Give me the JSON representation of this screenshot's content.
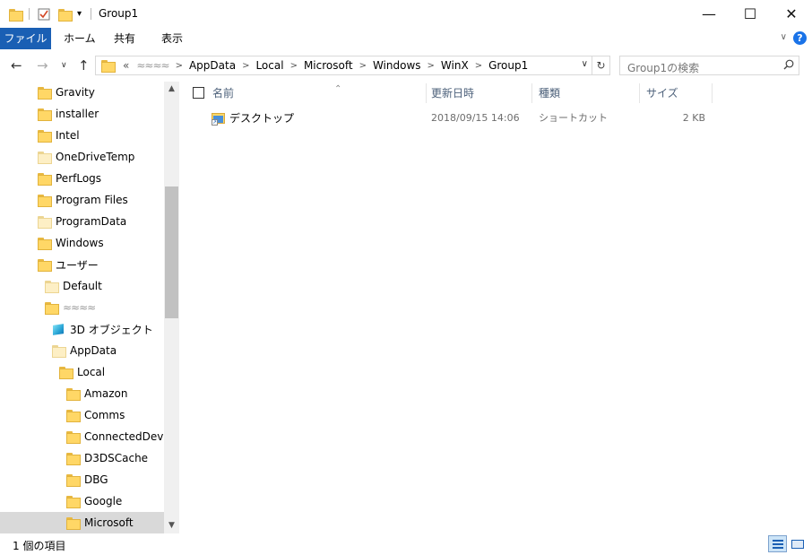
{
  "window": {
    "title": "Group1",
    "controls": {
      "minimize": "—",
      "maximize": "☐",
      "close": "✕"
    }
  },
  "ribbon": {
    "tabs": [
      {
        "label": "ファイル"
      },
      {
        "label": "ホーム"
      },
      {
        "label": "共有"
      },
      {
        "label": "表示"
      }
    ],
    "help": "?"
  },
  "address_bar": {
    "overflow": "«",
    "breadcrumbs": [
      "≈≈≈≈",
      "AppData",
      "Local",
      "Microsoft",
      "Windows",
      "WinX",
      "Group1"
    ]
  },
  "search": {
    "placeholder": "Group1の検索"
  },
  "tree": {
    "items": [
      {
        "label": "Gravity",
        "icon": "folder-icon",
        "indent": 0
      },
      {
        "label": "installer",
        "icon": "folder-icon",
        "indent": 0
      },
      {
        "label": "Intel",
        "icon": "folder-icon",
        "indent": 0
      },
      {
        "label": "OneDriveTemp",
        "icon": "folder-pale-icon",
        "indent": 0
      },
      {
        "label": "PerfLogs",
        "icon": "folder-icon",
        "indent": 0
      },
      {
        "label": "Program Files",
        "icon": "folder-icon",
        "indent": 0
      },
      {
        "label": "ProgramData",
        "icon": "folder-pale-icon",
        "indent": 0
      },
      {
        "label": "Windows",
        "icon": "folder-icon",
        "indent": 0
      },
      {
        "label": "ユーザー",
        "icon": "folder-icon",
        "indent": 0
      },
      {
        "label": "Default",
        "icon": "folder-pale-icon",
        "indent": 1
      },
      {
        "label": "≈≈≈≈",
        "icon": "folder-icon",
        "indent": 1
      },
      {
        "label": "3D オブジェクト",
        "icon": "cube-icon",
        "indent": 2
      },
      {
        "label": "AppData",
        "icon": "folder-pale-icon",
        "indent": 2
      },
      {
        "label": "Local",
        "icon": "folder-icon",
        "indent": 3
      },
      {
        "label": "Amazon",
        "icon": "folder-icon",
        "indent": 4
      },
      {
        "label": "Comms",
        "icon": "folder-icon",
        "indent": 4
      },
      {
        "label": "ConnectedDevice",
        "icon": "folder-icon",
        "indent": 4
      },
      {
        "label": "D3DSCache",
        "icon": "folder-icon",
        "indent": 4
      },
      {
        "label": "DBG",
        "icon": "folder-icon",
        "indent": 4
      },
      {
        "label": "Google",
        "icon": "folder-icon",
        "indent": 4
      },
      {
        "label": "Microsoft",
        "icon": "folder-icon",
        "indent": 4,
        "selected": true
      }
    ]
  },
  "file_list": {
    "columns": {
      "name": "名前",
      "modified": "更新日時",
      "type": "種類",
      "size": "サイズ"
    },
    "rows": [
      {
        "name": "デスクトップ",
        "modified": "2018/09/15 14:06",
        "type": "ショートカット",
        "size": "2 KB",
        "icon": "shortcut-icon"
      }
    ]
  },
  "status": {
    "item_count": "1 個の項目"
  },
  "colors": {
    "file_tab": "#1a5fb4",
    "selection": "#d9d9d9",
    "folder": "#ffd766"
  }
}
